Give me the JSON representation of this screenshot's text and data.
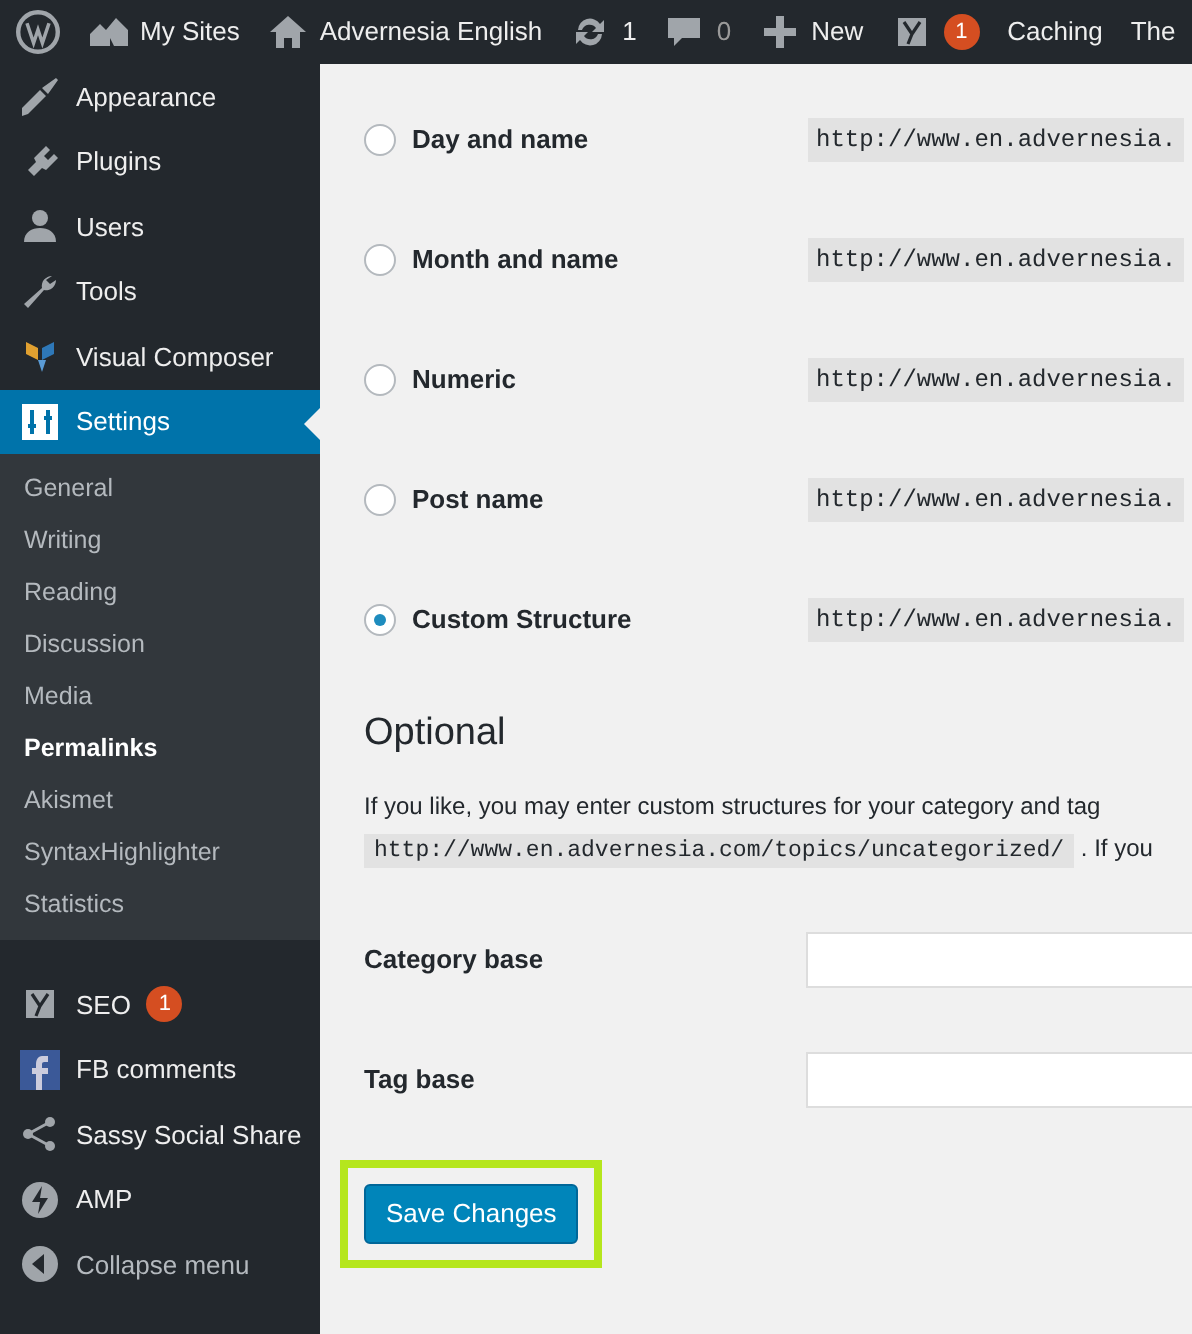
{
  "admin_bar": {
    "items": [
      {
        "kind": "logo"
      },
      {
        "kind": "link",
        "label": "My Sites"
      },
      {
        "kind": "link",
        "label": "Advernesia English"
      },
      {
        "kind": "count",
        "label": "1"
      },
      {
        "kind": "count",
        "label": "0"
      },
      {
        "kind": "link",
        "label": "New"
      },
      {
        "kind": "badge",
        "label": "1"
      },
      {
        "kind": "text",
        "label": "Caching"
      },
      {
        "kind": "text",
        "label": "The"
      }
    ]
  },
  "sidebar": {
    "items": [
      {
        "label": "Appearance",
        "selected": false
      },
      {
        "label": "Plugins",
        "selected": false
      },
      {
        "label": "Users",
        "selected": false
      },
      {
        "label": "Tools",
        "selected": false
      },
      {
        "label": "Visual Composer",
        "selected": false
      },
      {
        "label": "Settings",
        "selected": true,
        "children": [
          {
            "label": "General",
            "selected": false
          },
          {
            "label": "Writing",
            "selected": false
          },
          {
            "label": "Reading",
            "selected": false
          },
          {
            "label": "Discussion",
            "selected": false
          },
          {
            "label": "Media",
            "selected": false
          },
          {
            "label": "Permalinks",
            "selected": true
          },
          {
            "label": "Akismet",
            "selected": false
          },
          {
            "label": "SyntaxHighlighter",
            "selected": false
          },
          {
            "label": "Statistics",
            "selected": false
          }
        ]
      },
      {
        "label": "SEO",
        "selected": false,
        "badge": "1"
      },
      {
        "label": "FB comments",
        "selected": false
      },
      {
        "label": "Sassy Social Share",
        "selected": false
      },
      {
        "label": "AMP",
        "selected": false
      },
      {
        "label": "Collapse menu",
        "selected": false
      }
    ]
  },
  "permalink_options": [
    {
      "label": "Day and name",
      "selected": false,
      "example": "http://www.en.advernesia."
    },
    {
      "label": "Month and name",
      "selected": false,
      "example": "http://www.en.advernesia."
    },
    {
      "label": "Numeric",
      "selected": false,
      "example": "http://www.en.advernesia."
    },
    {
      "label": "Post name",
      "selected": false,
      "example": "http://www.en.advernesia."
    },
    {
      "label": "Custom Structure",
      "selected": true,
      "example": "http://www.en.advernesia."
    }
  ],
  "optional": {
    "heading": "Optional",
    "description": "If you like, you may enter custom structures for your category and tag",
    "example": "http://www.en.advernesia.com/topics/uncategorized/",
    "description_end": ". If you",
    "fields": [
      {
        "label": "Category base"
      },
      {
        "label": "Tag base"
      }
    ]
  },
  "save_button": {
    "label": "Save Changes",
    "highlighted": true
  }
}
